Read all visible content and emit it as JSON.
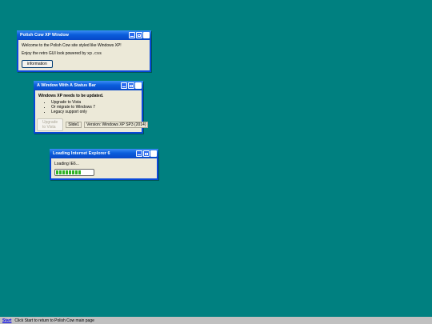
{
  "window1": {
    "title": "Polish Cow XP Window",
    "text1": "Welcome to the Polish Cow site styled like Windows XP!",
    "text2_prefix": "Enjoy the retro GUI look powered by ",
    "text2_code": "xp.css",
    "button_label": "information"
  },
  "window2": {
    "title": "A Window With A Status Bar",
    "heading": "Windows XP needs to be updated.",
    "items": [
      "Upgrade to Vista",
      "Or migrate to Windows 7",
      "Legacy support only"
    ],
    "button_label": "Upgrade to Vista",
    "status_slide": "Slide1",
    "status_version": "Version: Windows XP SP3 (2014)"
  },
  "window3": {
    "title": "Loading Internet Explorer 6",
    "loading_text": "Loading IE6...",
    "progress_segments": 8
  },
  "taskbar": {
    "start_label": "Start",
    "hint": "Click Start to return to Polish Cow main page"
  },
  "colors": {
    "desktop": "#008080",
    "titlebar": "#0a5ddb",
    "window_bg": "#ece9d8",
    "progress": "#2fb325"
  }
}
